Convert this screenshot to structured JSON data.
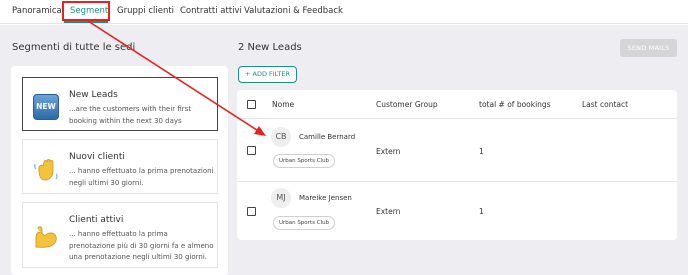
{
  "tabs": [
    {
      "label": "Panoramica"
    },
    {
      "label": "Segmenti"
    },
    {
      "label": "Gruppi clienti"
    },
    {
      "label": "Contratti attivi"
    },
    {
      "label": "Valutazioni & Feedback"
    }
  ],
  "active_tab": "Segmenti",
  "left_panel": {
    "title": "Segmenti di tutte le sedi",
    "segments": [
      {
        "icon": "new-badge-icon",
        "badge_text": "NEW",
        "title": "New Leads",
        "description": "...are the customers with their first booking within the next 30 days"
      },
      {
        "icon": "waving-hand-icon",
        "title": "Nuovi clienti",
        "description": "... hanno effettuato la prima prenotazioni negli ultimi 30 giorni."
      },
      {
        "icon": "flexed-biceps-icon",
        "title": "Clienti attivi",
        "description": "... hanno effettuato la prima prenotazione più di 30 giorni fa e almeno una prenotazione negli ultimi 30 giorni."
      }
    ]
  },
  "right_panel": {
    "title": "2 New Leads",
    "send_mails_label": "SEND MAILS",
    "add_filter_label": "+ ADD FILTER",
    "columns": [
      "Nome",
      "Customer Group",
      "total # of bookings",
      "Last contact"
    ],
    "rows": [
      {
        "initials": "CB",
        "name": "Camille Bernard",
        "tag": "Urban Sports Club",
        "group": "Extern",
        "bookings": "1",
        "last_contact": ""
      },
      {
        "initials": "MJ",
        "name": "Mareike Jensen",
        "tag": "Urban Sports Club",
        "group": "Extern",
        "bookings": "1",
        "last_contact": ""
      }
    ]
  },
  "colors": {
    "accent": "#1f8f84",
    "highlight": "#e8211f",
    "background": "#ededf2"
  }
}
